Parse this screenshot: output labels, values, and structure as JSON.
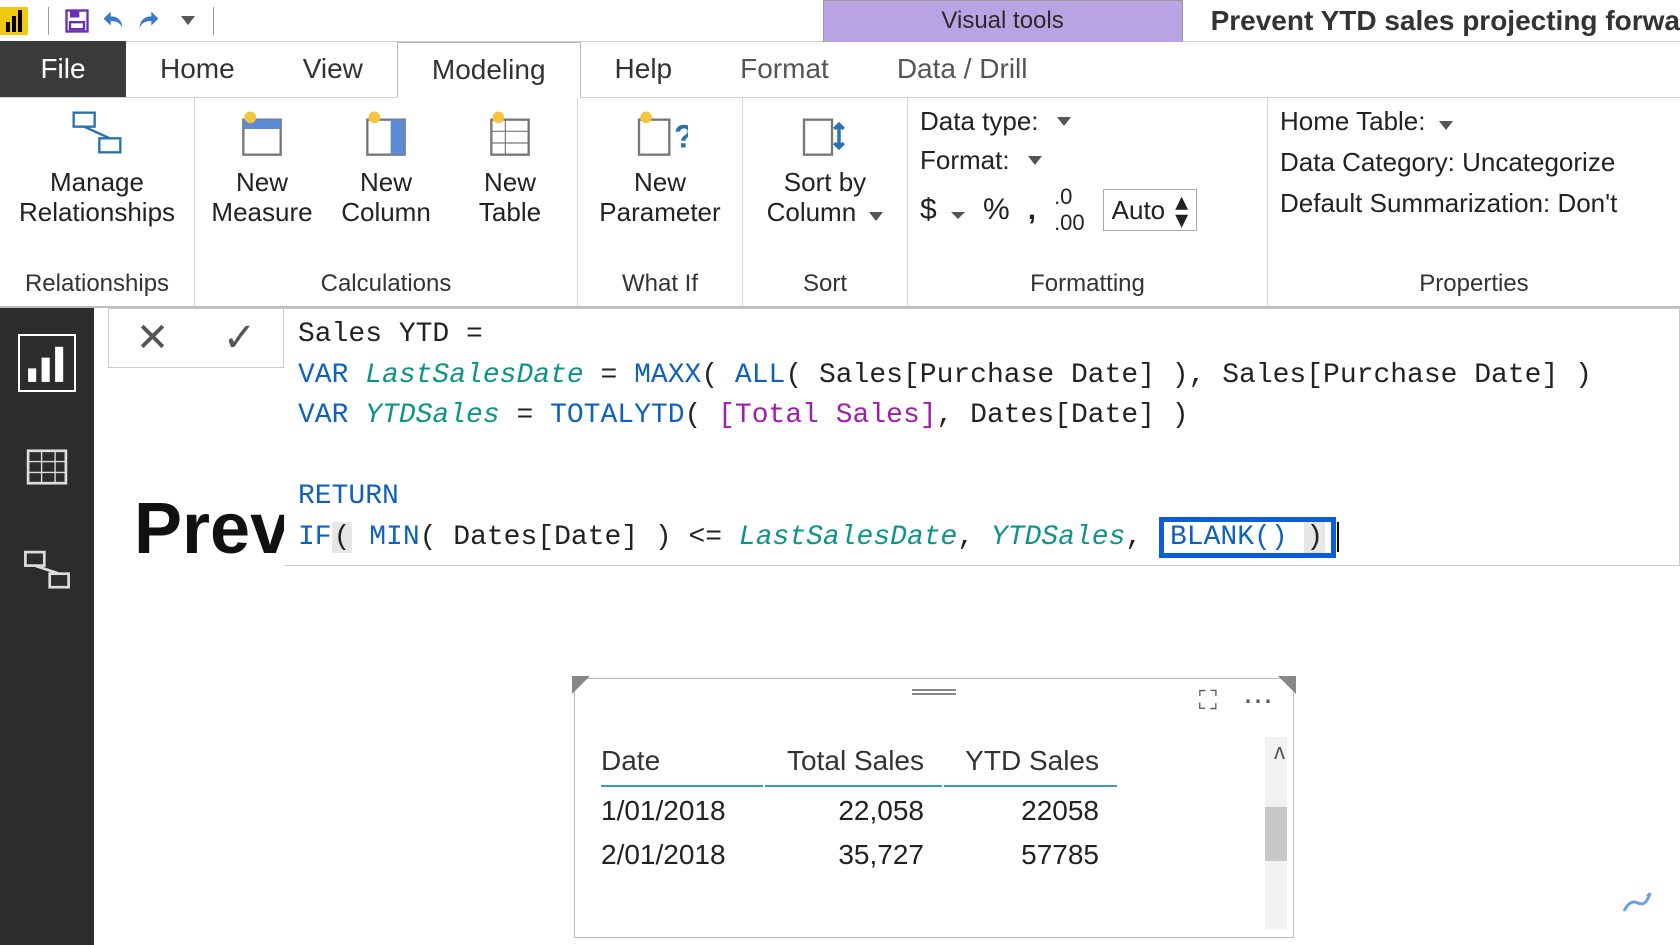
{
  "qat": {
    "context_tab": "Visual tools",
    "doc_title": "Prevent YTD sales projecting forwa"
  },
  "tabs": {
    "file": "File",
    "home": "Home",
    "view": "View",
    "modeling": "Modeling",
    "help": "Help",
    "format": "Format",
    "datadrill": "Data / Drill"
  },
  "ribbon": {
    "relationships": {
      "manage": "Manage\nRelationships",
      "group": "Relationships"
    },
    "calculations": {
      "measure": "New\nMeasure",
      "column": "New\nColumn",
      "table": "New\nTable",
      "group": "Calculations"
    },
    "whatif": {
      "param": "New\nParameter",
      "group": "What If"
    },
    "sort": {
      "sortby": "Sort by\nColumn",
      "group": "Sort"
    },
    "formatting": {
      "datatype": "Data type:",
      "format": "Format:",
      "auto": "Auto",
      "group": "Formatting"
    },
    "properties": {
      "hometable": "Home Table:",
      "datacat": "Data Category: Uncategorize",
      "defsum": "Default Summarization: Don't",
      "group": "Properties"
    }
  },
  "formula": {
    "l1a": "Sales YTD = ",
    "l2_var": "VAR",
    "l2_name": " LastSalesDate",
    "l2_eq": " = ",
    "l2_fn1": "MAXX",
    "l2_p1": "( ",
    "l2_fn2": "ALL",
    "l2_p2": "( Sales[Purchase Date] ), Sales[Purchase Date] )",
    "l3_var": "VAR",
    "l3_name": " YTDSales",
    "l3_eq": " = ",
    "l3_fn": "TOTALYTD",
    "l3_p1": "( ",
    "l3_meas": "[Total Sales]",
    "l3_rest": ", Dates[Date] )",
    "l5_ret": "RETURN",
    "l6_if": "IF",
    "l6_p1": "(",
    "l6_sp": " ",
    "l6_min": "MIN",
    "l6_minargs": "( Dates[Date] ) <= ",
    "l6_lsd": "LastSalesDate",
    "l6_c1": ", ",
    "l6_ytd": "YTDSales",
    "l6_c2": ", ",
    "l6_blank": "BLANK() ",
    "l6_close": ")"
  },
  "canvas": {
    "preview_title": "Prev"
  },
  "table": {
    "headers": [
      "Date",
      "Total Sales",
      "YTD Sales"
    ],
    "rows": [
      {
        "date": "1/01/2018",
        "total": "22,058",
        "ytd": "22058"
      },
      {
        "date": "2/01/2018",
        "total": "35,727",
        "ytd": "57785"
      }
    ]
  }
}
